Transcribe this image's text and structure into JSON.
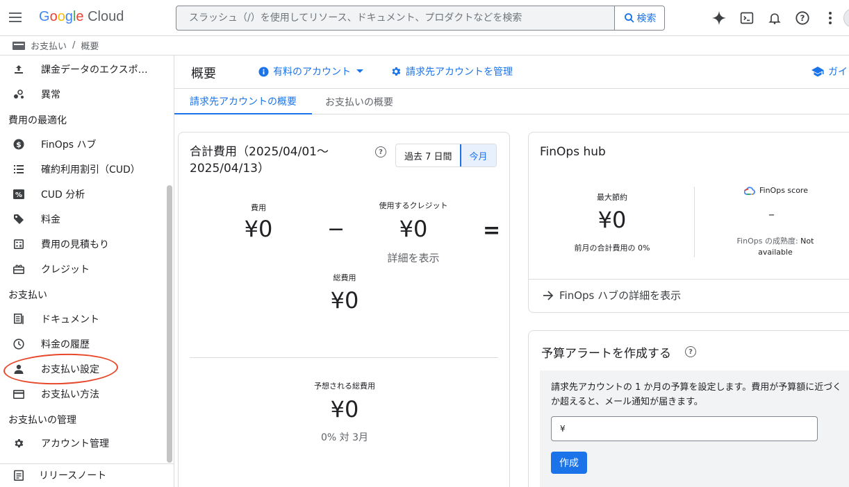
{
  "header": {
    "logo_google": [
      "G",
      "o",
      "o",
      "g",
      "l",
      "e"
    ],
    "logo_cloud": "Cloud",
    "search_placeholder": "スラッシュ（/）を使用してリソース、ドキュメント、プロダクトなどを検索",
    "search_button": "検索"
  },
  "breadcrumb": {
    "items": [
      "お支払い",
      "概要"
    ],
    "separator": "/"
  },
  "sidebar": {
    "items": [
      {
        "label": "課金データのエクスポ…",
        "icon": "upload-icon"
      },
      {
        "label": "異常",
        "icon": "anomaly-icon"
      },
      {
        "heading": "費用の最適化"
      },
      {
        "label": "FinOps ハブ",
        "icon": "dollar-icon"
      },
      {
        "label": "確約利用割引（CUD）",
        "icon": "list-icon"
      },
      {
        "label": "CUD 分析",
        "icon": "percent-icon"
      },
      {
        "label": "料金",
        "icon": "tag-icon"
      },
      {
        "label": "費用の見積もり",
        "icon": "calculator-icon"
      },
      {
        "label": "クレジット",
        "icon": "gift-icon"
      },
      {
        "heading": "お支払い"
      },
      {
        "label": "ドキュメント",
        "icon": "document-icon"
      },
      {
        "label": "料金の履歴",
        "icon": "clock-icon"
      },
      {
        "label": "お支払い設定",
        "icon": "person-icon"
      },
      {
        "label": "お支払い方法",
        "icon": "credit-card-icon"
      },
      {
        "heading": "お支払いの管理"
      },
      {
        "label": "アカウント管理",
        "icon": "gear-icon"
      }
    ],
    "release_notes": "リリースノート"
  },
  "main": {
    "title": "概要",
    "account_link": "有料のアカウント",
    "manage_link": "請求先アカウントを管理",
    "guide_link": "ガイ",
    "tabs": [
      "請求先アカウントの概要",
      "お支払いの概要"
    ]
  },
  "cost_card": {
    "title": "合計費用（2025/04/01〜2025/04/13）",
    "range_options": [
      "過去 7 日間",
      "今月"
    ],
    "selected_range": "今月",
    "cost_label": "費用",
    "cost_value": "¥0",
    "minus": "−",
    "credit_label": "使用するクレジット",
    "credit_value": "¥0",
    "equals": "=",
    "details_link": "詳細を表示",
    "total_label": "総費用",
    "total_value": "¥0",
    "forecast_label": "予想される総費用",
    "forecast_value": "¥0",
    "forecast_compare": "0% 対 3月"
  },
  "finops_card": {
    "title": "FinOps hub",
    "max_savings_label": "最大節約",
    "max_savings_value": "¥0",
    "max_savings_sub": "前月の合計費用の 0%",
    "score_label": "FinOps score",
    "score_value": "–",
    "maturity_label": "FinOps の成熟度:",
    "maturity_value": "Not available",
    "view_link": "FinOps ハブの詳細を表示"
  },
  "budget_card": {
    "title": "予算アラートを作成する",
    "description": "請求先アカウントの 1 か月の予算を設定します。費用が予算額に近づくか超えると、メール通知が届きます。",
    "currency": "¥",
    "create_button": "作成"
  },
  "colors": {
    "accent": "#1a73e8",
    "highlight": "#e8472b",
    "text": "#202124",
    "muted": "#5f6368"
  }
}
